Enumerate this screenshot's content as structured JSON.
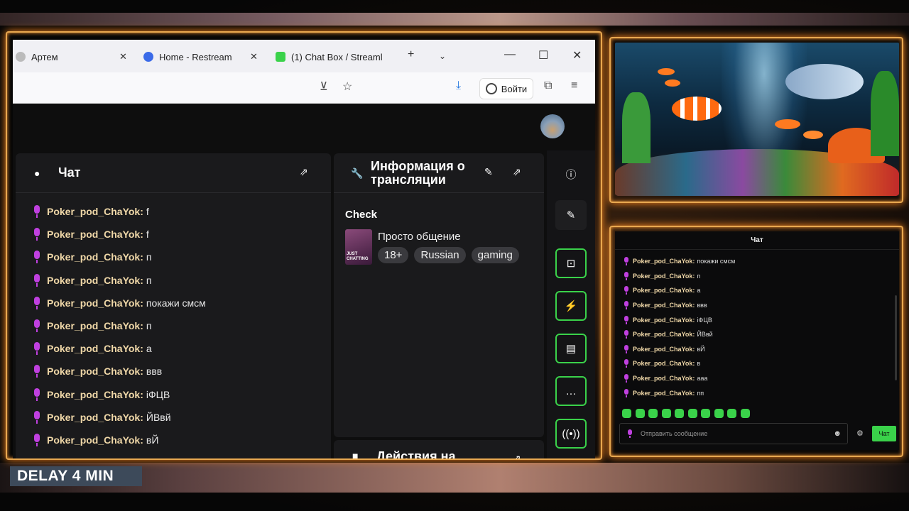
{
  "browser": {
    "tabs": [
      {
        "label": "Артем"
      },
      {
        "label": "Home - Restream"
      },
      {
        "label": "(1) Chat Box / Streaml"
      }
    ],
    "signin_label": "Войти"
  },
  "chat_panel": {
    "title": "Чат",
    "messages": [
      {
        "user": "Poker_pod_ChaYok:",
        "text": "f"
      },
      {
        "user": "Poker_pod_ChaYok:",
        "text": "f"
      },
      {
        "user": "Poker_pod_ChaYok:",
        "text": "п"
      },
      {
        "user": "Poker_pod_ChaYok:",
        "text": "п"
      },
      {
        "user": "Poker_pod_ChaYok:",
        "text": "покажи смсм"
      },
      {
        "user": "Poker_pod_ChaYok:",
        "text": "п"
      },
      {
        "user": "Poker_pod_ChaYok:",
        "text": "а"
      },
      {
        "user": "Poker_pod_ChaYok:",
        "text": "ввв"
      },
      {
        "user": "Poker_pod_ChaYok:",
        "text": "іФЦВ"
      },
      {
        "user": "Poker_pod_ChaYok:",
        "text": "ЙВвй"
      },
      {
        "user": "Poker_pod_ChaYok:",
        "text": "вЙ"
      }
    ]
  },
  "info_panel": {
    "title_line1": "Информация о",
    "title_line2": "трансляции",
    "stream_title": "Check",
    "category": "Просто общение",
    "category_thumb_text": "JUST CHATTING",
    "tags": [
      "18+",
      "Russian",
      "gaming"
    ]
  },
  "actions_panel": {
    "title": "Действия на"
  },
  "overlay": {
    "delay_label": "DELAY 4 MIN"
  },
  "chat_widget": {
    "title": "Чат",
    "messages": [
      {
        "user": "Poker_pod_ChaYok:",
        "text": "покажи смсм"
      },
      {
        "user": "Poker_pod_ChaYok:",
        "text": "п"
      },
      {
        "user": "Poker_pod_ChaYok:",
        "text": "а"
      },
      {
        "user": "Poker_pod_ChaYok:",
        "text": "ввв"
      },
      {
        "user": "Poker_pod_ChaYok:",
        "text": "іФЦВ"
      },
      {
        "user": "Poker_pod_ChaYok:",
        "text": "ЙВвй"
      },
      {
        "user": "Poker_pod_ChaYok:",
        "text": "вЙ"
      },
      {
        "user": "Poker_pod_ChaYok:",
        "text": "в"
      },
      {
        "user": "Poker_pod_ChaYok:",
        "text": "ааа"
      },
      {
        "user": "Poker_pod_ChaYok:",
        "text": "пп"
      }
    ],
    "input_placeholder": "Отправить сообщение",
    "send_label": "Чат"
  },
  "colors": {
    "accent_green": "#3ad24a",
    "frame_orange": "#e8a850",
    "username": "#f0d8a8",
    "mic_purple": "#c040e0"
  }
}
